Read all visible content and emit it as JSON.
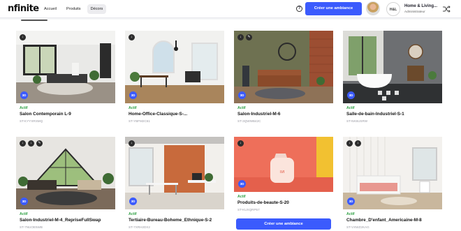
{
  "header": {
    "logo": "nfinite",
    "nav": [
      "Accueil",
      "Produits",
      "Décors"
    ],
    "active_nav": "Décors",
    "help": "?",
    "create_label": "Créer une ambiance",
    "brand_logo_text": "H&L",
    "user_name": "Home & Living...",
    "user_role": "Administrateur"
  },
  "badge_3d": "3D",
  "colors": {
    "accent": "#3b5bfd",
    "status_active": "#2ea043"
  },
  "cards": [
    {
      "status": "Actif",
      "title": "Salon Contemporain L-9",
      "code": "ST-KYYXRSMQ"
    },
    {
      "status": "Actif",
      "title": "Home-Office-Classique-S-...",
      "code": "ST-YBFM2C61"
    },
    {
      "status": "Actif",
      "title": "Salon-Industriel-M-6",
      "code": "ST-3QWWB42C"
    },
    {
      "status": "Actif",
      "title": "Salle-de-bain-Industriel-S-1",
      "code": "ST-NK6USRW"
    },
    {
      "status": "Actif",
      "title": "Salon-Industriel-M-4_RepriseFullSwap",
      "code": "ST-7NUOE5WB"
    },
    {
      "status": "Actif",
      "title": "Tertiaire-Bureau-Boheme_Ethnique-S-2",
      "code": "ST-7XRH2DX2"
    },
    {
      "status": "Actif",
      "title": "Produits-de-beaute-S-20",
      "code": "ST-KUXQRP57"
    },
    {
      "status": "Actif",
      "title": "Chambre_D'enfant_Americaine-M-8",
      "code": "ST-VXWZ2KAG"
    }
  ],
  "card_create_label": "Créer une ambiance"
}
